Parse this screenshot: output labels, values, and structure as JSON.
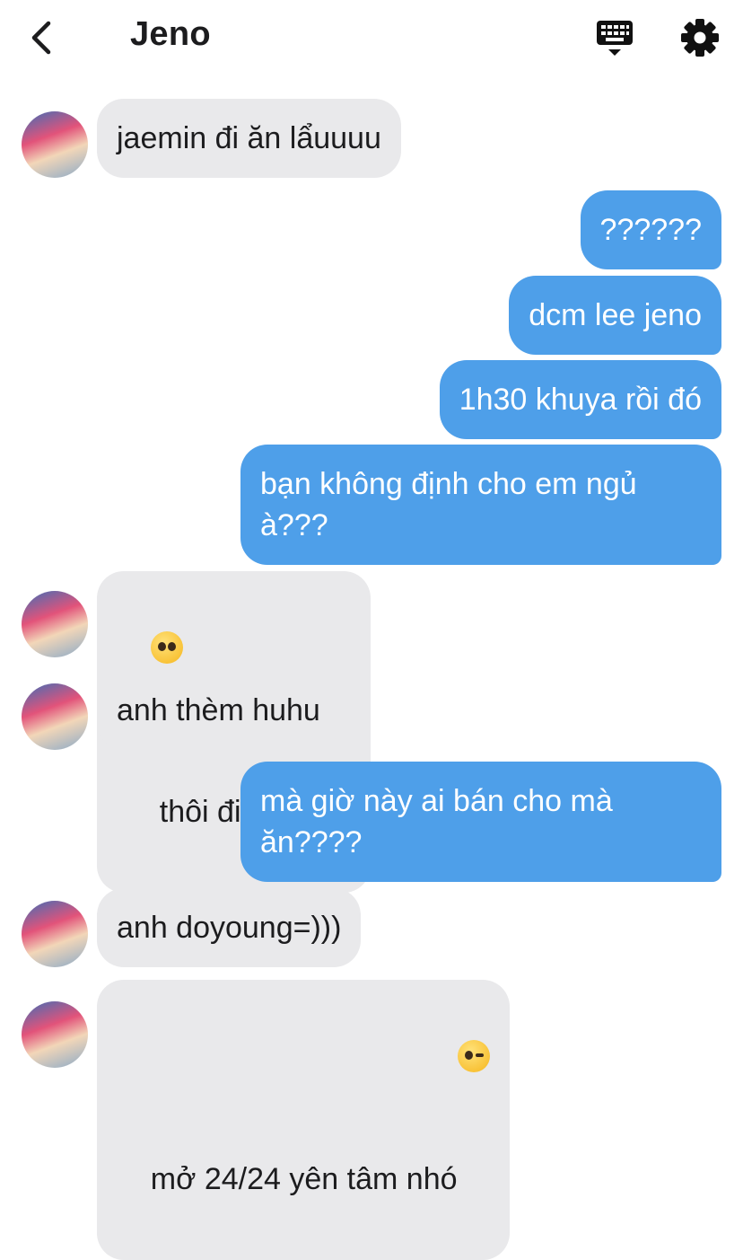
{
  "header": {
    "title": "Jeno",
    "back_icon": "chevron-left-icon",
    "keyboard_icon": "keyboard-icon",
    "settings_icon": "gear-icon"
  },
  "colors": {
    "outgoing_bubble": "#4e9fe9",
    "incoming_bubble": "#e9e9eb"
  },
  "messages": [
    {
      "dir": "in",
      "text": "jaemin đi ăn lẩuuuu"
    },
    {
      "dir": "out",
      "text": "??????"
    },
    {
      "dir": "out",
      "text": "dcm lee jeno"
    },
    {
      "dir": "out",
      "text": "1h30 khuya rồi đó"
    },
    {
      "dir": "out",
      "text": "bạn không định cho em ngủ à???"
    },
    {
      "dir": "in",
      "emoji": "pleading-face-emoji",
      "text": "thôi đi với anh"
    },
    {
      "dir": "in",
      "text": "anh thèm huhu"
    },
    {
      "dir": "out",
      "text": "mà giờ này ai bán cho mà ăn????"
    },
    {
      "dir": "in",
      "text": "anh doyoung=)))"
    },
    {
      "dir": "in",
      "text": "mở 24/24 yên tâm nhó",
      "emoji": "winking-face-emoji"
    }
  ]
}
